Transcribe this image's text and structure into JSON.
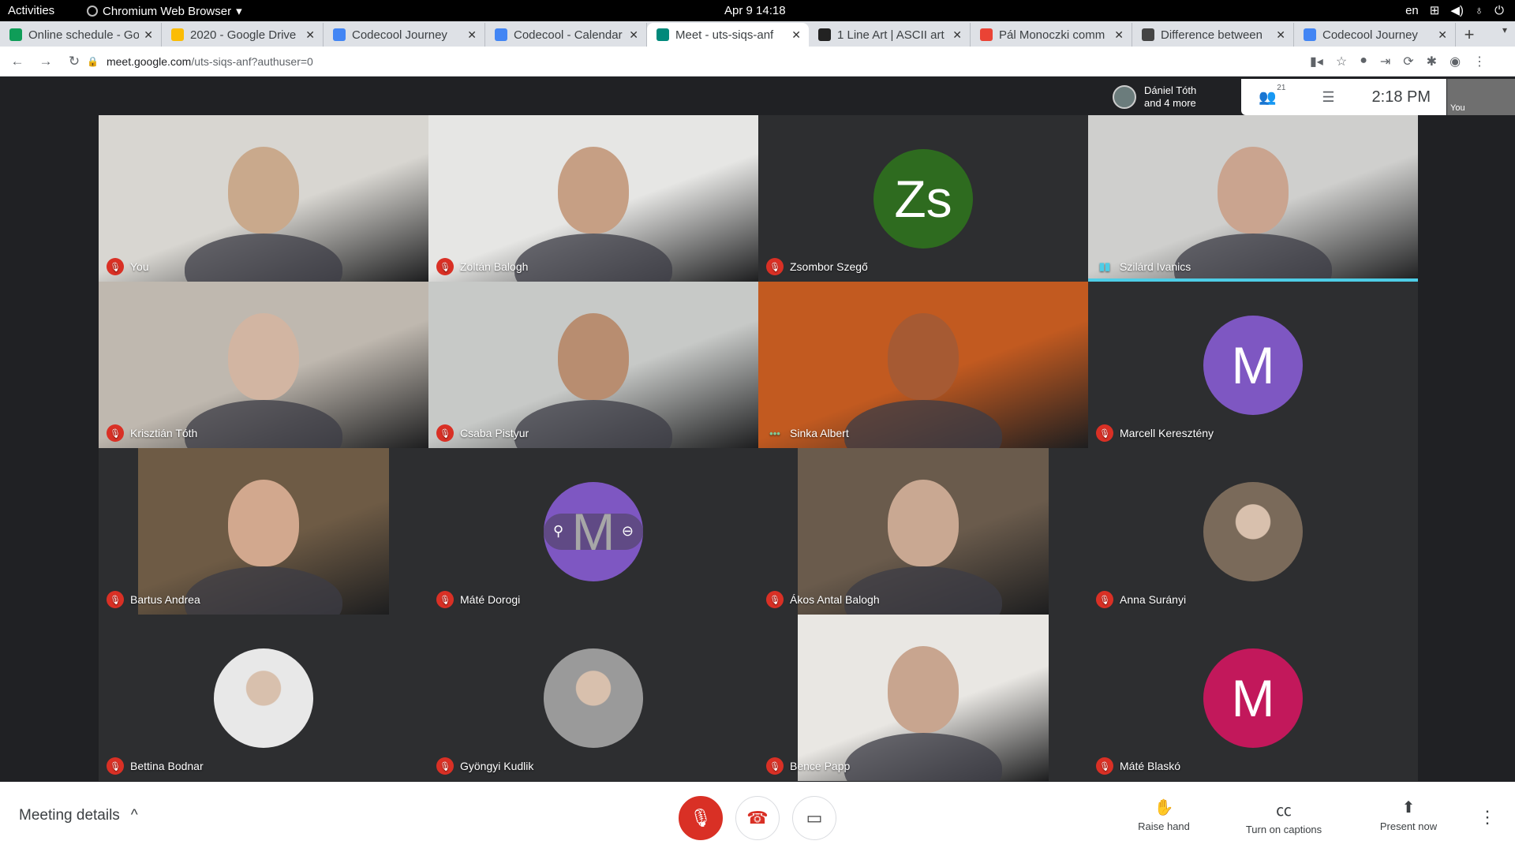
{
  "topbar": {
    "activities": "Activities",
    "app": "Chromium Web Browser",
    "clock": "Apr 9  14:18",
    "lang": "en"
  },
  "tabs": [
    {
      "title": "Online schedule - Go",
      "color": "#0f9d58"
    },
    {
      "title": "2020 - Google Drive",
      "color": "#fbbc04"
    },
    {
      "title": "Codecool Journey",
      "color": "#4285f4"
    },
    {
      "title": "Codecool - Calendar",
      "color": "#4285f4"
    },
    {
      "title": "Meet - uts-siqs-anf",
      "color": "#00897b"
    },
    {
      "title": "1 Line Art | ASCII art",
      "color": "#222222"
    },
    {
      "title": "Pál Monoczki comm",
      "color": "#ea4335"
    },
    {
      "title": "Difference between",
      "color": "#444444"
    },
    {
      "title": "Codecool Journey",
      "color": "#4285f4"
    }
  ],
  "address": {
    "host": "meet.google.com",
    "path": "/uts-siqs-anf?authuser=0"
  },
  "meet": {
    "presenters": {
      "name": "Dániel Tóth",
      "more": "and 4 more"
    },
    "people_count": "21",
    "time": "2:18 PM",
    "self_label": "You",
    "participants": [
      {
        "name": "You",
        "type": "video",
        "bg": "#d8d6d1",
        "skin": "#c9a98c"
      },
      {
        "name": "Zoltán Balogh",
        "type": "video",
        "bg": "#e6e6e4",
        "skin": "#c69f84"
      },
      {
        "name": "Zsombor Szegő",
        "type": "avatar",
        "initials": "Zs",
        "color": "#2e6b1f"
      },
      {
        "name": "Szilárd Ivanics",
        "type": "video",
        "bg": "#cfcfcd",
        "skin": "#caa48f",
        "speaking": true
      },
      {
        "name": "Krisztián Tóth",
        "type": "video",
        "bg": "#bfb8af",
        "skin": "#d2b5a2"
      },
      {
        "name": "Csaba Pistyur",
        "type": "video",
        "bg": "#c7c9c7",
        "skin": "#b88d70"
      },
      {
        "name": "Sinka Albert",
        "type": "video",
        "bg": "#c25a20",
        "skin": "#a65a33",
        "dots": true
      },
      {
        "name": "Marcell Keresztény",
        "type": "avatar",
        "initials": "M",
        "color": "#7e57c2"
      },
      {
        "name": "Bartus Andrea",
        "type": "video",
        "bg": "#6e5b45",
        "skin": "#d2a88e",
        "narrow": true
      },
      {
        "name": "Máté Dorogi",
        "type": "avatar",
        "initials": "M",
        "color": "#7e57c2",
        "hover": true
      },
      {
        "name": "Ákos Antal Balogh",
        "type": "video",
        "bg": "#6a5b4c",
        "skin": "#c9a892",
        "narrow": true
      },
      {
        "name": "Anna Surányi",
        "type": "photo",
        "color": "#7a6a5a"
      },
      {
        "name": "Bettina Bodnar",
        "type": "photo",
        "color": "#e8e8e8"
      },
      {
        "name": "Gyöngyi Kudlik",
        "type": "photo",
        "color": "#9a9a9a"
      },
      {
        "name": "Bence Papp",
        "type": "video",
        "bg": "#e9e7e3",
        "skin": "#c8a58f",
        "narrow": true
      },
      {
        "name": "Máté Blaskó",
        "type": "avatar",
        "initials": "M",
        "color": "#c2185b"
      }
    ]
  },
  "bottom": {
    "details": "Meeting details",
    "raise_hand": "Raise hand",
    "captions": "Turn on captions",
    "present": "Present now"
  }
}
